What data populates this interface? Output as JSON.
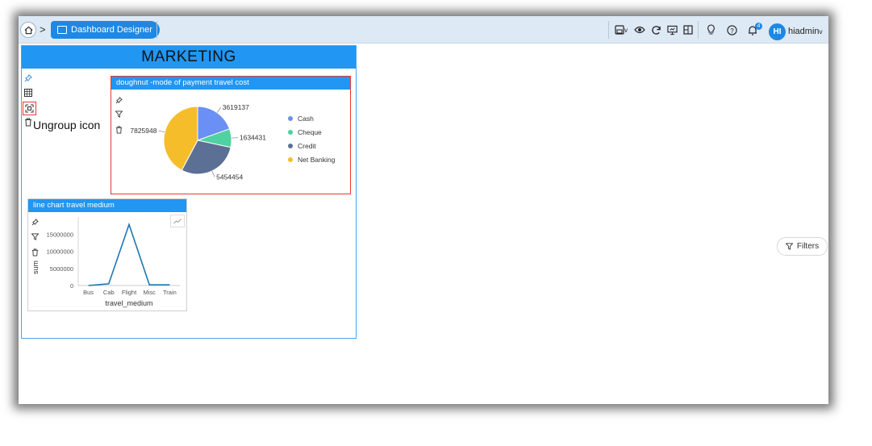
{
  "breadcrumb": {
    "label": "Dashboard Designer"
  },
  "user": {
    "initials": "HI",
    "name": "hiadmin",
    "notifications": "4"
  },
  "group": {
    "title": "MARKETING",
    "callout": "Ungroup icon"
  },
  "doughnut_widget": {
    "title": "doughnut -mode of payment travel cost",
    "chart_data": {
      "type": "pie",
      "slices": [
        {
          "label": "Cash",
          "value": 3619137,
          "color": "#6a8ff5"
        },
        {
          "label": "Cheque",
          "value": 1634431,
          "color": "#4fd1a1"
        },
        {
          "label": "Credit",
          "value": 5454454,
          "color": "#5c6f94"
        },
        {
          "label": "Net Banking",
          "value": 7825948,
          "color": "#f6bd2a"
        }
      ],
      "data_labels": [
        "3619137",
        "1634431",
        "5454454",
        "7825948"
      ],
      "legend_position": "right"
    }
  },
  "line_widget": {
    "title": "line chart travel medium",
    "chart_data": {
      "type": "line",
      "categories": [
        "Bus",
        "Cab",
        "Flight",
        "Misc",
        "Train"
      ],
      "values": [
        0,
        500000,
        17800000,
        200000,
        200000
      ],
      "xlabel": "travel_medium",
      "ylabel": "sum",
      "yticks": [
        "15000000",
        "10000000",
        "5000000",
        "0"
      ],
      "ylim": [
        0,
        20000000
      ],
      "color": "#1f77b4"
    }
  },
  "filters": {
    "label": "Filters"
  }
}
